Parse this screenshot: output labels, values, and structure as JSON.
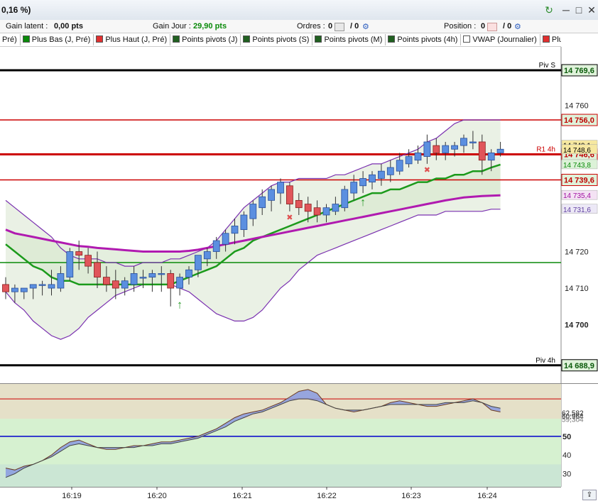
{
  "titlebar": {
    "change_pct": "0,16 %)",
    "refresh_icon": "refresh-icon",
    "minimize": "─",
    "restore": "□",
    "close": "✕"
  },
  "status": {
    "latent_label": "Gain latent :",
    "latent_value": "0,00 pts",
    "day_label": "Gain Jour :",
    "day_value": "29,90 pts",
    "orders_label": "Ordres :",
    "orders_count": "0",
    "orders_slash": "/ 0",
    "position_label": "Position :",
    "position_count": "0",
    "position_slash": "/ 0"
  },
  "legend": [
    {
      "label": "Pré)",
      "color": ""
    },
    {
      "label": "Plus Bas (J, Pré)",
      "color": "#0a8a0a"
    },
    {
      "label": "Plus Haut (J, Pré)",
      "color": "#e03030"
    },
    {
      "label": "Points pivots (J)",
      "color": "#206020"
    },
    {
      "label": "Points pivots (S)",
      "color": "#206020"
    },
    {
      "label": "Points pivots (M)",
      "color": "#206020"
    },
    {
      "label": "Points pivots (4h)",
      "color": "#206020"
    },
    {
      "label": "VWAP (Journalier)",
      "color": "#ffffff"
    },
    {
      "label": "Plus Ha",
      "color": "#e03030"
    }
  ],
  "chart_data": [
    {
      "type": "candlestick",
      "ylim": [
        14684,
        14776
      ],
      "y_ticks": [
        "14 760",
        "14 720",
        "14 710",
        "14 700"
      ],
      "x_ticks": [
        "16:19",
        "16:20",
        "16:21",
        "16:22",
        "16:23",
        "16:24"
      ],
      "levels": [
        {
          "name": "Piv S",
          "value": 14769.6,
          "label": "14 769,6",
          "color": "#000000"
        },
        {
          "name": "",
          "value": 14756.0,
          "label": "14 756,0",
          "color": "#cc0000"
        },
        {
          "name": "R1 4h",
          "value": 14746.6,
          "label": "14 746,6",
          "color": "#cc0000"
        },
        {
          "name": "",
          "value": 14739.6,
          "label": "14 739,6",
          "color": "#cc0000"
        },
        {
          "name": "",
          "value": 14717.0,
          "label": "",
          "color": "#0a8a0a"
        },
        {
          "name": "Piv 4h",
          "value": 14688.9,
          "label": "14 688,9",
          "color": "#000000"
        }
      ],
      "right_labels": [
        {
          "text": "14 749,1",
          "value": 14749.1,
          "color": "#000000",
          "bg": "#f6e8a0"
        },
        {
          "text": "14 748,6",
          "value": 14747.9,
          "color": "#000000",
          "bg": "#f6e8a0"
        },
        {
          "text": "14 743,8",
          "value": 14743.8,
          "color": "#0a8a0a",
          "bg": "#dcf2d8"
        },
        {
          "text": "14 735,4",
          "value": 14735.4,
          "color": "#a010a0",
          "bg": "#f4e2f4"
        },
        {
          "text": "14 731,6",
          "value": 14731.6,
          "color": "#6040a0",
          "bg": "#ece8f6"
        }
      ],
      "candles": [
        {
          "o": 14711,
          "h": 14713,
          "l": 14707,
          "c": 14709
        },
        {
          "o": 14709,
          "h": 14711,
          "l": 14706,
          "c": 14710
        },
        {
          "o": 14709,
          "h": 14710,
          "l": 14707,
          "c": 14710
        },
        {
          "o": 14710,
          "h": 14711,
          "l": 14707,
          "c": 14711
        },
        {
          "o": 14711,
          "h": 14712,
          "l": 14708,
          "c": 14711
        },
        {
          "o": 14710,
          "h": 14715,
          "l": 14708,
          "c": 14711
        },
        {
          "o": 14710,
          "h": 14716,
          "l": 14709,
          "c": 14714
        },
        {
          "o": 14713,
          "h": 14721,
          "l": 14712,
          "c": 14720
        },
        {
          "o": 14720,
          "h": 14723,
          "l": 14715,
          "c": 14719
        },
        {
          "o": 14719,
          "h": 14721,
          "l": 14714,
          "c": 14716
        },
        {
          "o": 14717,
          "h": 14720,
          "l": 14710,
          "c": 14713
        },
        {
          "o": 14713,
          "h": 14716,
          "l": 14709,
          "c": 14711
        },
        {
          "o": 14712,
          "h": 14715,
          "l": 14707,
          "c": 14710
        },
        {
          "o": 14710,
          "h": 14713,
          "l": 14708,
          "c": 14712
        },
        {
          "o": 14711,
          "h": 14716,
          "l": 14709,
          "c": 14714
        },
        {
          "o": 14713,
          "h": 14715,
          "l": 14710,
          "c": 14713
        },
        {
          "o": 14713,
          "h": 14715,
          "l": 14709,
          "c": 14714
        },
        {
          "o": 14714,
          "h": 14716,
          "l": 14709,
          "c": 14714
        },
        {
          "o": 14714,
          "h": 14715,
          "l": 14705,
          "c": 14710
        },
        {
          "o": 14710,
          "h": 14714,
          "l": 14708,
          "c": 14713
        },
        {
          "o": 14713,
          "h": 14716,
          "l": 14711,
          "c": 14715
        },
        {
          "o": 14715,
          "h": 14719,
          "l": 14713,
          "c": 14719
        },
        {
          "o": 14718,
          "h": 14721,
          "l": 14716,
          "c": 14720
        },
        {
          "o": 14720,
          "h": 14724,
          "l": 14718,
          "c": 14723
        },
        {
          "o": 14722,
          "h": 14726,
          "l": 14720,
          "c": 14725
        },
        {
          "o": 14725,
          "h": 14729,
          "l": 14722,
          "c": 14727
        },
        {
          "o": 14726,
          "h": 14731,
          "l": 14724,
          "c": 14730
        },
        {
          "o": 14729,
          "h": 14734,
          "l": 14727,
          "c": 14733
        },
        {
          "o": 14732,
          "h": 14737,
          "l": 14730,
          "c": 14735
        },
        {
          "o": 14734,
          "h": 14738,
          "l": 14731,
          "c": 14737
        },
        {
          "o": 14736,
          "h": 14740,
          "l": 14733,
          "c": 14739
        },
        {
          "o": 14738,
          "h": 14739,
          "l": 14731,
          "c": 14733
        },
        {
          "o": 14734,
          "h": 14736,
          "l": 14730,
          "c": 14732
        },
        {
          "o": 14733,
          "h": 14735,
          "l": 14728,
          "c": 14731
        },
        {
          "o": 14732,
          "h": 14734,
          "l": 14728,
          "c": 14730
        },
        {
          "o": 14730,
          "h": 14733,
          "l": 14728,
          "c": 14732
        },
        {
          "o": 14731,
          "h": 14735,
          "l": 14730,
          "c": 14733
        },
        {
          "o": 14732,
          "h": 14738,
          "l": 14731,
          "c": 14737
        },
        {
          "o": 14736,
          "h": 14741,
          "l": 14734,
          "c": 14739
        },
        {
          "o": 14738,
          "h": 14742,
          "l": 14736,
          "c": 14740
        },
        {
          "o": 14739,
          "h": 14742,
          "l": 14737,
          "c": 14741
        },
        {
          "o": 14740,
          "h": 14744,
          "l": 14738,
          "c": 14742
        },
        {
          "o": 14741,
          "h": 14745,
          "l": 14739,
          "c": 14743
        },
        {
          "o": 14742,
          "h": 14747,
          "l": 14741,
          "c": 14745
        },
        {
          "o": 14744,
          "h": 14748,
          "l": 14743,
          "c": 14746
        },
        {
          "o": 14745,
          "h": 14749,
          "l": 14744,
          "c": 14747
        },
        {
          "o": 14746,
          "h": 14752,
          "l": 14744,
          "c": 14750
        },
        {
          "o": 14749,
          "h": 14751,
          "l": 14745,
          "c": 14747
        },
        {
          "o": 14747,
          "h": 14750,
          "l": 14745,
          "c": 14749
        },
        {
          "o": 14748,
          "h": 14750,
          "l": 14746,
          "c": 14749
        },
        {
          "o": 14749,
          "h": 14752,
          "l": 14747,
          "c": 14751
        },
        {
          "o": 14750,
          "h": 14753,
          "l": 14748,
          "c": 14750
        },
        {
          "o": 14750,
          "h": 14752,
          "l": 14741,
          "c": 14745
        },
        {
          "o": 14745,
          "h": 14748,
          "l": 14742,
          "c": 14747
        },
        {
          "o": 14747,
          "h": 14750,
          "l": 14746,
          "c": 14748
        }
      ],
      "ma_green": [
        14722,
        14720,
        14718,
        14716,
        14715,
        14713,
        14712,
        14712,
        14711,
        14711,
        14711,
        14711,
        14711,
        14711,
        14711,
        14711,
        14711,
        14711,
        14711,
        14712,
        14713,
        14714,
        14715,
        14716,
        14718,
        14720,
        14721,
        14723,
        14724,
        14725,
        14726,
        14727,
        14728,
        14729,
        14730,
        14731,
        14732,
        14733,
        14734,
        14735,
        14736,
        14736,
        14737,
        14737,
        14738,
        14739,
        14739,
        14740,
        14740,
        14741,
        14741,
        14742,
        14742,
        14743,
        14743.8
      ],
      "ma_purple": [
        14726,
        14725,
        14724.5,
        14724,
        14723.5,
        14723,
        14722.5,
        14722,
        14721.5,
        14721.3,
        14721,
        14720.8,
        14720.6,
        14720.4,
        14720.2,
        14720,
        14720,
        14720,
        14720,
        14720,
        14720.2,
        14720.5,
        14721,
        14721.5,
        14722,
        14722.5,
        14723,
        14723.5,
        14724,
        14724.5,
        14725,
        14725.5,
        14726,
        14726.5,
        14727,
        14727.5,
        14728,
        14728.5,
        14729,
        14729.5,
        14730,
        14730.5,
        14731,
        14731.5,
        14732,
        14732.5,
        14733,
        14733.5,
        14734,
        14734.4,
        14734.8,
        14735,
        14735.2,
        14735.3,
        14735.4
      ],
      "bb_upper": [
        14734,
        14732,
        14730,
        14728,
        14726,
        14724,
        14721,
        14719,
        14718,
        14718,
        14718,
        14717,
        14717,
        14716,
        14716,
        14717,
        14717,
        14717,
        14718,
        14718,
        14719,
        14720,
        14721,
        14723,
        14726,
        14729,
        14732,
        14734,
        14736,
        14738,
        14739,
        14739,
        14740,
        14740,
        14740,
        14740,
        14741,
        14741,
        14742,
        14743,
        14744,
        14744,
        14745,
        14746,
        14747,
        14748,
        14750,
        14751,
        14753,
        14755,
        14756,
        14756,
        14756,
        14756,
        14756
      ],
      "bb_lower": [
        14709,
        14706,
        14704,
        14701,
        14699,
        14697,
        14696,
        14697,
        14699,
        14702,
        14704,
        14706,
        14708,
        14709,
        14710,
        14711,
        14711,
        14711,
        14711,
        14710,
        14709,
        14707,
        14705,
        14703,
        14702,
        14701,
        14701,
        14702,
        14704,
        14707,
        14710,
        14712,
        14715,
        14717,
        14719,
        14720,
        14721,
        14722,
        14723,
        14724,
        14725,
        14726,
        14727,
        14728,
        14729,
        14730,
        14730,
        14730,
        14731,
        14731,
        14731,
        14731,
        14731,
        14731.6,
        14731.6
      ],
      "bands_fill": "#d8e8d0",
      "sar_up_arrows": [
        19,
        39
      ],
      "sar_down_x": [
        31,
        46
      ]
    },
    {
      "type": "area",
      "ylim": [
        23,
        78
      ],
      "y_ticks": [
        "50",
        "40",
        "30"
      ],
      "levels": [
        {
          "value": 70,
          "color": "#cc0000"
        },
        {
          "value": 50,
          "color": "#0000cc"
        }
      ],
      "right_labels": [
        {
          "text": "62,582",
          "value": 62.58,
          "color": "#222222"
        },
        {
          "text": "60,964",
          "value": 61.0,
          "color": "#222222"
        },
        {
          "text": "59,304",
          "value": 59.3,
          "color": "#777777"
        }
      ],
      "series": [
        {
          "values": [
            33,
            32,
            34,
            35,
            37,
            40,
            44,
            47,
            48,
            46,
            44,
            43,
            43,
            44,
            45,
            45,
            46,
            47,
            47,
            48,
            49,
            50,
            52,
            54,
            57,
            60,
            62,
            63,
            64,
            66,
            68,
            71,
            74,
            75,
            73,
            67,
            65,
            64,
            63,
            64,
            65,
            66,
            68,
            69,
            68,
            67,
            66,
            66,
            67,
            68,
            69,
            70,
            68,
            64,
            63
          ]
        },
        {
          "values": [
            28,
            30,
            33,
            35,
            37,
            39,
            42,
            45,
            46,
            45,
            44,
            44,
            44,
            44,
            44,
            45,
            45,
            46,
            46,
            47,
            48,
            49,
            51,
            53,
            55,
            58,
            60,
            62,
            63,
            65,
            67,
            69,
            70,
            70,
            69,
            67,
            65,
            64,
            64,
            64,
            65,
            66,
            67,
            67,
            67,
            67,
            67,
            67,
            68,
            68,
            68,
            69,
            68,
            66,
            65
          ]
        }
      ]
    }
  ]
}
